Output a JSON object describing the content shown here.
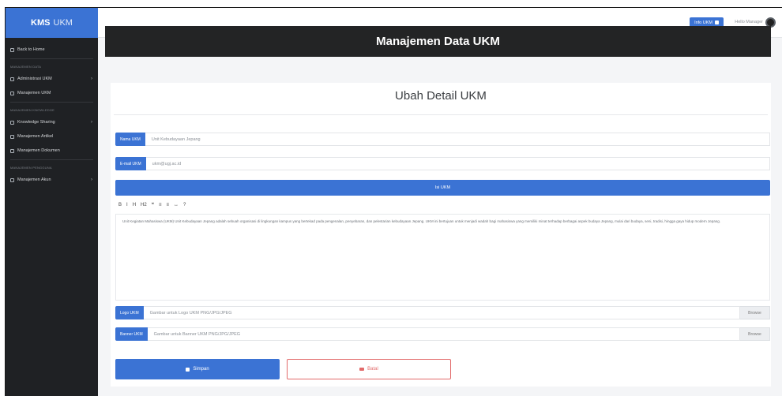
{
  "brand": {
    "name": "KMS",
    "sub": "UKM"
  },
  "sidebar": {
    "items": [
      {
        "label": "Back to Home"
      },
      {
        "heading": "MANAJEMEN DATA"
      },
      {
        "label": "Administrasi UKM",
        "chevron": "›"
      },
      {
        "label": "Manajemen UKM"
      },
      {
        "heading": "MANAJEMEN KNOWLEDGE"
      },
      {
        "label": "Knowledge Sharing",
        "chevron": "›"
      },
      {
        "label": "Manajemen Artikel"
      },
      {
        "label": "Manajemen Dokumen"
      },
      {
        "heading": "MANAJEMEN PENGGUNA"
      },
      {
        "label": "Manajemen Akun",
        "chevron": "›"
      }
    ]
  },
  "topbar": {
    "button_label": "Info UKM",
    "user_label": "Hello Manager"
  },
  "header": {
    "title": "Manajemen Data UKM"
  },
  "form": {
    "title": "Ubah Detail UKM",
    "nama": {
      "label": "Nama UKM",
      "value": "Unit Kebudayaan Jepang"
    },
    "email": {
      "label": "E-mail UKM",
      "value": "ukm@ugj.ac.id"
    },
    "isi_label": "Isi UKM",
    "toolbar": [
      "B",
      "I",
      "H",
      "H2",
      "❝",
      "≡",
      "≡",
      "↔",
      "?"
    ],
    "editor_text": "Unit Kegiatan Mahasiswa (UKM) Unit Kebudayaan Jepang adalah sebuah organisasi di lingkungan kampus yang bertekad pada pengenalan, penyebaran, dan pelestarian kebudayaan Jepang. UKM ini bertujuan untuk menjadi wadah bagi mahasiswa yang memiliki minat terhadap berbagai aspek budaya Jepang, mulai dari budaya, seni, tradisi, hingga gaya hidup modern Jepang.",
    "logo": {
      "label": "Logo UKM",
      "placeholder": "Gambar untuk Logo UKM PNG/JPG/JPEG",
      "browse": "Browse"
    },
    "banner": {
      "label": "Banner UKM",
      "placeholder": "Gambar untuk Banner UKM PNG/JPG/JPEG",
      "browse": "Browse"
    },
    "save_label": "Simpan",
    "back_label": "Batal"
  },
  "colors": {
    "primary": "#3b73d4",
    "sidebar": "#1f2124",
    "header": "#232425",
    "danger": "#e26a6a"
  }
}
